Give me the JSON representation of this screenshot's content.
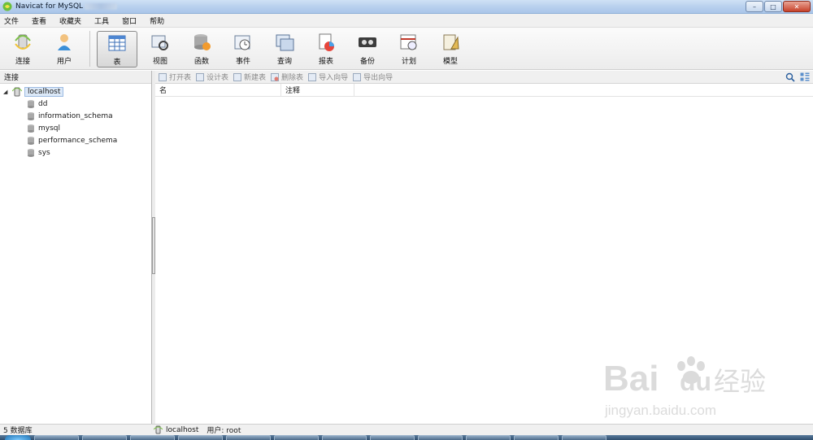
{
  "window": {
    "title": "Navicat for MySQL",
    "controls": {
      "minimize": "–",
      "maximize": "□",
      "close": "✕"
    }
  },
  "menu": [
    "文件",
    "查看",
    "收藏夹",
    "工具",
    "窗口",
    "帮助"
  ],
  "toolbar": [
    {
      "label": "连接",
      "icon": "connection-icon"
    },
    {
      "label": "用户",
      "icon": "user-icon"
    },
    {
      "label": "表",
      "icon": "table-icon",
      "active": true
    },
    {
      "label": "视图",
      "icon": "view-icon"
    },
    {
      "label": "函数",
      "icon": "function-icon"
    },
    {
      "label": "事件",
      "icon": "event-icon"
    },
    {
      "label": "查询",
      "icon": "query-icon"
    },
    {
      "label": "报表",
      "icon": "report-icon"
    },
    {
      "label": "备份",
      "icon": "backup-icon"
    },
    {
      "label": "计划",
      "icon": "schedule-icon"
    },
    {
      "label": "模型",
      "icon": "model-icon"
    }
  ],
  "left_panel": {
    "header": "连接",
    "tree": {
      "root": {
        "label": "localhost",
        "expander": "◢"
      },
      "children": [
        "dd",
        "information_schema",
        "mysql",
        "performance_schema",
        "sys"
      ]
    }
  },
  "object_toolbar": {
    "buttons": [
      "打开表",
      "设计表",
      "新建表",
      "删除表",
      "导入向导",
      "导出向导"
    ]
  },
  "list": {
    "columns": [
      "名",
      "注释"
    ]
  },
  "status": {
    "db_count": "5 数据库",
    "connection": "localhost",
    "user": "用户: root"
  },
  "watermark": {
    "brand": "Bai",
    "brand2": "du",
    "cn": "经验",
    "url": "jingyan.baidu.com"
  },
  "colors": {
    "accent": "#3a7bd5",
    "selection": "#dce9f8"
  }
}
